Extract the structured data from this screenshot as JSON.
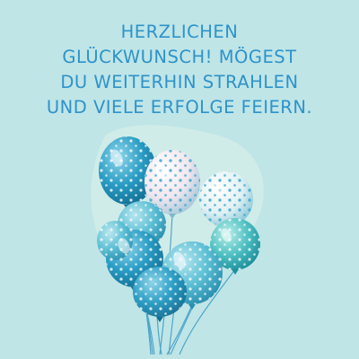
{
  "card": {
    "background": "#bfe5e7",
    "text_color": "#2e93c9",
    "greeting_lines": [
      "HERZLICHEN",
      "GLÜCKWUNSCH! MÖGEST",
      "DU WEITERHIN STRAHLEN",
      "UND VIELE ERFOLGE FEIERN."
    ]
  },
  "illustration": {
    "subject": "balloon-bouquet",
    "balloon_count": 9,
    "palette": [
      "#1f8fb4",
      "#5fc2d6",
      "#8fd0e0",
      "#d9eef1",
      "#f2e6ea"
    ]
  }
}
